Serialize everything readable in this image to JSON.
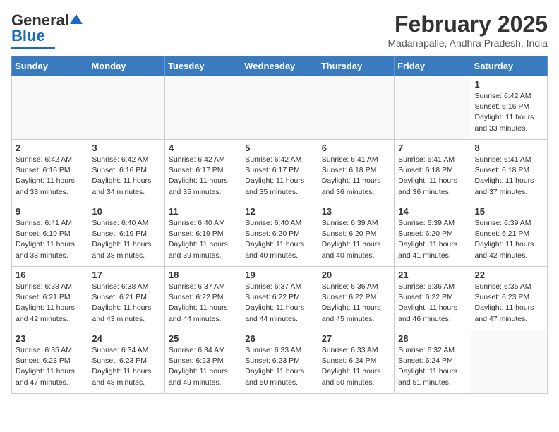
{
  "header": {
    "logo_general": "General",
    "logo_blue": "Blue",
    "month_title": "February 2025",
    "subtitle": "Madanapalle, Andhra Pradesh, India"
  },
  "days_of_week": [
    "Sunday",
    "Monday",
    "Tuesday",
    "Wednesday",
    "Thursday",
    "Friday",
    "Saturday"
  ],
  "weeks": [
    [
      {
        "day": "",
        "info": ""
      },
      {
        "day": "",
        "info": ""
      },
      {
        "day": "",
        "info": ""
      },
      {
        "day": "",
        "info": ""
      },
      {
        "day": "",
        "info": ""
      },
      {
        "day": "",
        "info": ""
      },
      {
        "day": "1",
        "info": "Sunrise: 6:42 AM\nSunset: 6:16 PM\nDaylight: 11 hours\nand 33 minutes."
      }
    ],
    [
      {
        "day": "2",
        "info": "Sunrise: 6:42 AM\nSunset: 6:16 PM\nDaylight: 11 hours\nand 33 minutes."
      },
      {
        "day": "3",
        "info": "Sunrise: 6:42 AM\nSunset: 6:16 PM\nDaylight: 11 hours\nand 34 minutes."
      },
      {
        "day": "4",
        "info": "Sunrise: 6:42 AM\nSunset: 6:17 PM\nDaylight: 11 hours\nand 35 minutes."
      },
      {
        "day": "5",
        "info": "Sunrise: 6:42 AM\nSunset: 6:17 PM\nDaylight: 11 hours\nand 35 minutes."
      },
      {
        "day": "6",
        "info": "Sunrise: 6:41 AM\nSunset: 6:18 PM\nDaylight: 11 hours\nand 36 minutes."
      },
      {
        "day": "7",
        "info": "Sunrise: 6:41 AM\nSunset: 6:18 PM\nDaylight: 11 hours\nand 36 minutes."
      },
      {
        "day": "8",
        "info": "Sunrise: 6:41 AM\nSunset: 6:18 PM\nDaylight: 11 hours\nand 37 minutes."
      }
    ],
    [
      {
        "day": "9",
        "info": "Sunrise: 6:41 AM\nSunset: 6:19 PM\nDaylight: 11 hours\nand 38 minutes."
      },
      {
        "day": "10",
        "info": "Sunrise: 6:40 AM\nSunset: 6:19 PM\nDaylight: 11 hours\nand 38 minutes."
      },
      {
        "day": "11",
        "info": "Sunrise: 6:40 AM\nSunset: 6:19 PM\nDaylight: 11 hours\nand 39 minutes."
      },
      {
        "day": "12",
        "info": "Sunrise: 6:40 AM\nSunset: 6:20 PM\nDaylight: 11 hours\nand 40 minutes."
      },
      {
        "day": "13",
        "info": "Sunrise: 6:39 AM\nSunset: 6:20 PM\nDaylight: 11 hours\nand 40 minutes."
      },
      {
        "day": "14",
        "info": "Sunrise: 6:39 AM\nSunset: 6:20 PM\nDaylight: 11 hours\nand 41 minutes."
      },
      {
        "day": "15",
        "info": "Sunrise: 6:39 AM\nSunset: 6:21 PM\nDaylight: 11 hours\nand 42 minutes."
      }
    ],
    [
      {
        "day": "16",
        "info": "Sunrise: 6:38 AM\nSunset: 6:21 PM\nDaylight: 11 hours\nand 42 minutes."
      },
      {
        "day": "17",
        "info": "Sunrise: 6:38 AM\nSunset: 6:21 PM\nDaylight: 11 hours\nand 43 minutes."
      },
      {
        "day": "18",
        "info": "Sunrise: 6:37 AM\nSunset: 6:22 PM\nDaylight: 11 hours\nand 44 minutes."
      },
      {
        "day": "19",
        "info": "Sunrise: 6:37 AM\nSunset: 6:22 PM\nDaylight: 11 hours\nand 44 minutes."
      },
      {
        "day": "20",
        "info": "Sunrise: 6:36 AM\nSunset: 6:22 PM\nDaylight: 11 hours\nand 45 minutes."
      },
      {
        "day": "21",
        "info": "Sunrise: 6:36 AM\nSunset: 6:22 PM\nDaylight: 11 hours\nand 46 minutes."
      },
      {
        "day": "22",
        "info": "Sunrise: 6:35 AM\nSunset: 6:23 PM\nDaylight: 11 hours\nand 47 minutes."
      }
    ],
    [
      {
        "day": "23",
        "info": "Sunrise: 6:35 AM\nSunset: 6:23 PM\nDaylight: 11 hours\nand 47 minutes."
      },
      {
        "day": "24",
        "info": "Sunrise: 6:34 AM\nSunset: 6:23 PM\nDaylight: 11 hours\nand 48 minutes."
      },
      {
        "day": "25",
        "info": "Sunrise: 6:34 AM\nSunset: 6:23 PM\nDaylight: 11 hours\nand 49 minutes."
      },
      {
        "day": "26",
        "info": "Sunrise: 6:33 AM\nSunset: 6:23 PM\nDaylight: 11 hours\nand 50 minutes."
      },
      {
        "day": "27",
        "info": "Sunrise: 6:33 AM\nSunset: 6:24 PM\nDaylight: 11 hours\nand 50 minutes."
      },
      {
        "day": "28",
        "info": "Sunrise: 6:32 AM\nSunset: 6:24 PM\nDaylight: 11 hours\nand 51 minutes."
      },
      {
        "day": "",
        "info": ""
      }
    ]
  ]
}
